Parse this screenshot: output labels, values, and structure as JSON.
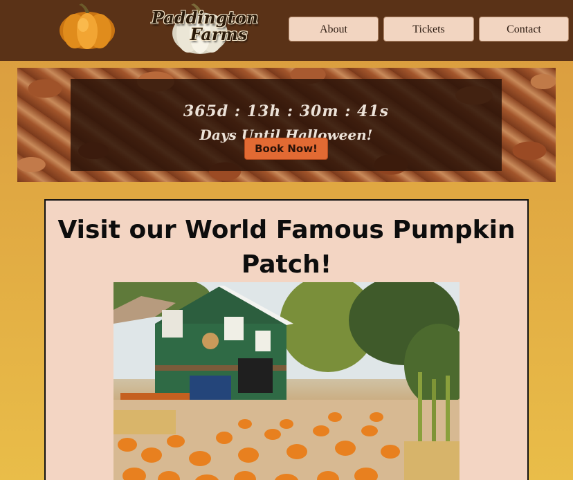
{
  "header": {
    "logo": {
      "line1": "Paddington",
      "line2": "Farms"
    },
    "nav": [
      {
        "label": "About"
      },
      {
        "label": "Tickets"
      },
      {
        "label": "Contact"
      }
    ]
  },
  "banner": {
    "countdown": "365d : 13h : 30m : 41s",
    "caption": "Days Until Halloween!",
    "book_label": "Book Now!"
  },
  "main": {
    "title": "Visit our World Famous Pumpkin Patch!"
  },
  "colors": {
    "header_bg": "#5a3217",
    "nav_button_bg": "#f2d5c1",
    "book_button_bg": "#e26a33",
    "card_bg": "#f3d5c3",
    "page_gradient_top": "#d99a3e",
    "page_gradient_bottom": "#e9bd49"
  },
  "icons": {
    "logo_left": "orange-pumpkin-icon",
    "logo_right": "white-pumpkin-icon"
  }
}
